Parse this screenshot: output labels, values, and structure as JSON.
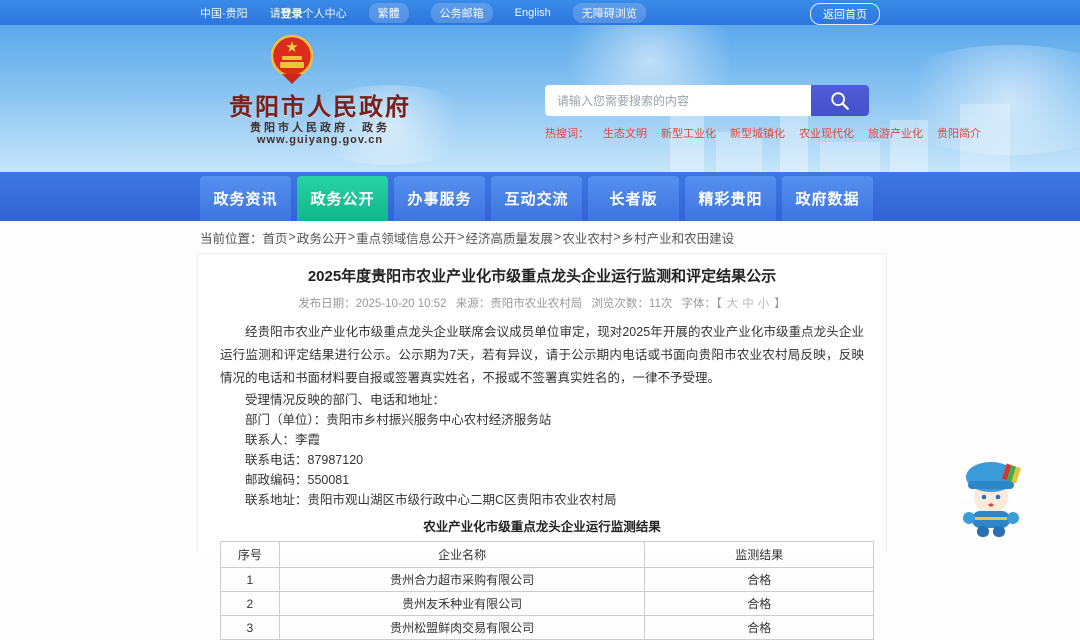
{
  "topbar": {
    "region": "中国·贵阳",
    "login_prefix": "请",
    "login_bold": "登录",
    "login_suffix": "个人中心",
    "traditional": "繁體",
    "mail": "公务邮箱",
    "english": "English",
    "accessibility": "无障碍浏览",
    "home_button": "返回首页"
  },
  "header": {
    "site_title": "贵阳市人民政府",
    "site_subtitle": "贵阳市人民政府．政务",
    "site_url": "www.guiyang.gov.cn",
    "search_placeholder": "请输入您需要搜索的内容",
    "hot_label": "热搜词：",
    "hot_words": [
      "生态文明",
      "新型工业化",
      "新型城镇化",
      "农业现代化",
      "旅游产业化",
      "贵阳简介"
    ]
  },
  "nav": {
    "items": [
      {
        "label": "政务资讯",
        "active": false
      },
      {
        "label": "政务公开",
        "active": true
      },
      {
        "label": "办事服务",
        "active": false
      },
      {
        "label": "互动交流",
        "active": false
      },
      {
        "label": "长者版",
        "active": false
      },
      {
        "label": "精彩贵阳",
        "active": false
      },
      {
        "label": "政府数据",
        "active": false
      }
    ],
    "active_color": "#1fc79a"
  },
  "breadcrumb": {
    "label": "当前位置：",
    "separator": ">",
    "path": [
      "首页",
      "政务公开",
      "重点领域信息公开",
      "经济高质量发展",
      "农业农村",
      "乡村产业和农田建设"
    ]
  },
  "article": {
    "title": "2025年度贵阳市农业产业化市级重点龙头企业运行监测和评定结果公示",
    "meta": {
      "date": "发布日期：2025-10-20 10:52",
      "source": "来源：贵阳市农业农村局",
      "views": "浏览次数：11次",
      "font_label": "字体：【",
      "font_large": "大",
      "font_medium": "中",
      "font_small": "小",
      "font_close": "】"
    },
    "paragraph": "经贵阳市农业产业化市级重点龙头企业联席会议成员单位审定，现对2025年开展的农业产业化市级重点龙头企业运行监测和评定结果进行公示。公示期为7天，若有异议，请于公示期内电话或书面向贵阳市农业农村局反映，反映情况的电话和书面材料要自报或签署真实姓名，不报或不签署真实姓名的，一律不予受理。",
    "contact_lines": [
      "受理情况反映的部门、电话和地址：",
      "部门（单位）：贵阳市乡村振兴服务中心农村经济服务站",
      "联系人：李霞",
      "联系电话：87987120",
      "邮政编码：550081",
      "联系地址：贵阳市观山湖区市级行政中心二期C区贵阳市农业农村局"
    ],
    "table": {
      "caption": "农业产业化市级重点龙头企业运行监测结果",
      "headers": [
        "序号",
        "企业名称",
        "监测结果"
      ],
      "rows": [
        [
          "1",
          "贵州合力超市采购有限公司",
          "合格"
        ],
        [
          "2",
          "贵州友禾种业有限公司",
          "合格"
        ],
        [
          "3",
          "贵州松盟鲜肉交易有限公司",
          "合格"
        ]
      ]
    }
  },
  "colors": {
    "topbar_blue": "#2d76dd",
    "nav_blue": "#3263d2",
    "active_green": "#1fc79a",
    "search_button_indigo": "#4a55d2",
    "hot_word_red": "#e0483e",
    "logo_maroon": "#7a201a"
  }
}
